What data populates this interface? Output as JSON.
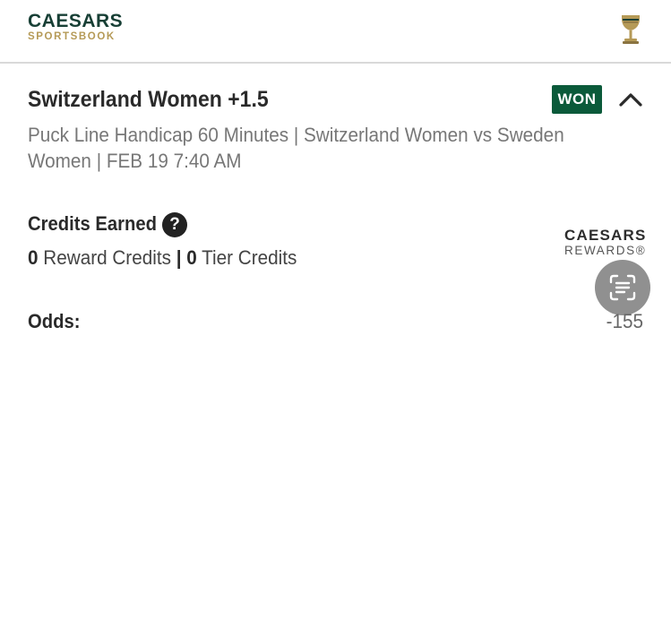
{
  "header": {
    "brand_main": "CAESARS",
    "brand_sub": "SPORTSBOOK",
    "trophy_icon": "trophy-icon"
  },
  "bet": {
    "title": "Switzerland Women +1.5",
    "status": "WON",
    "status_color": "#0b5a3a",
    "market": "Puck Line Handicap 60 Minutes | Switzerland Women vs Sweden Women | FEB 19  7:40 AM",
    "collapse_icon": "chevron-up-icon"
  },
  "credits": {
    "label": "Credits Earned",
    "help_icon": "?",
    "reward_value": "0",
    "reward_label": "Reward Credits",
    "separator": "|",
    "tier_value": "0",
    "tier_label": "Tier Credits"
  },
  "rewards_logo": {
    "main": "CAESARS",
    "sub": "REWARDS®"
  },
  "odds": {
    "label": "Odds:",
    "value": "-155"
  },
  "overlay": {
    "scan_icon": "text-scan-icon"
  },
  "colors": {
    "brand_green": "#173f35",
    "brand_gold": "#b59a57",
    "won_green": "#0b5a3a"
  }
}
